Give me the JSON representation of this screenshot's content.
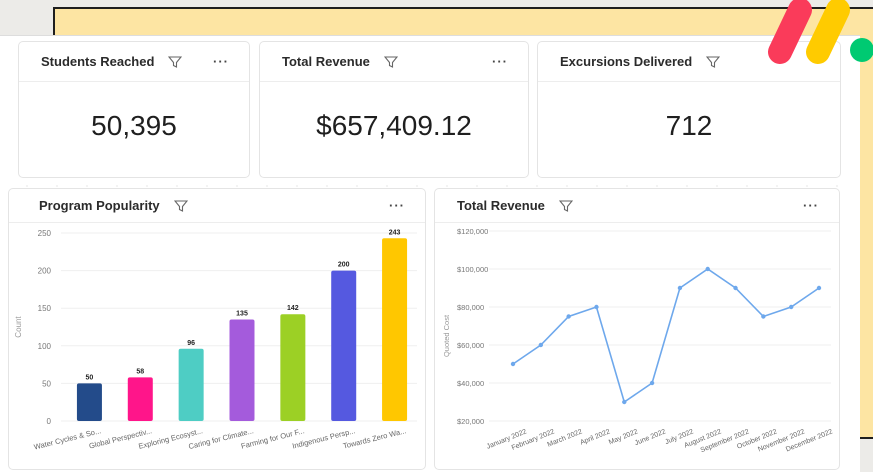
{
  "kpis": [
    {
      "title": "Students Reached",
      "value": "50,395"
    },
    {
      "title": "Total Revenue",
      "value": "$657,409.12"
    },
    {
      "title": "Excursions Delivered",
      "value": "712"
    }
  ],
  "more_label": "···",
  "colors": {
    "accent": "#fde5a3",
    "line": "#6ea8ec",
    "logo_red": "#fa3b5a",
    "logo_yellow": "#ffcb00",
    "logo_green": "#00ca72"
  },
  "charts": {
    "program_popularity": {
      "title": "Program Popularity"
    },
    "total_revenue": {
      "title": "Total Revenue"
    }
  },
  "chart_data": [
    {
      "type": "bar",
      "title": "Program Popularity",
      "ylabel": "Count",
      "ylim": [
        0,
        250
      ],
      "yticks": [
        0,
        50,
        100,
        150,
        200,
        250
      ],
      "categories": [
        "Water Cycles & So...",
        "Global Perspectiv...",
        "Exploring Ecosyst...",
        "Caring for Climate...",
        "Farming for Our F...",
        "Indigenous Persp...",
        "Towards Zero Wa..."
      ],
      "values": [
        50,
        58,
        96,
        135,
        142,
        200,
        243
      ],
      "colors": [
        "#234b8a",
        "#ff158a",
        "#4ecdc4",
        "#a45bdc",
        "#9cd025",
        "#5559e0",
        "#ffc700"
      ]
    },
    {
      "type": "line",
      "title": "Total Revenue",
      "ylabel": "Quoted Cost",
      "ylim": [
        20000,
        120000
      ],
      "ytick_labels": [
        "$20,000",
        "$40,000",
        "$60,000",
        "$80,000",
        "$100,000",
        "$120,000"
      ],
      "yticks": [
        20000,
        40000,
        60000,
        80000,
        100000,
        120000
      ],
      "categories": [
        "January 2022",
        "February 2022",
        "March 2022",
        "April 2022",
        "May 2022",
        "June 2022",
        "July 2022",
        "August 2022",
        "September 2022",
        "October 2022",
        "November 2022",
        "December 2022"
      ],
      "values": [
        50000,
        60000,
        75000,
        80000,
        30000,
        40000,
        90000,
        100000,
        90000,
        75000,
        80000,
        90000
      ]
    }
  ]
}
